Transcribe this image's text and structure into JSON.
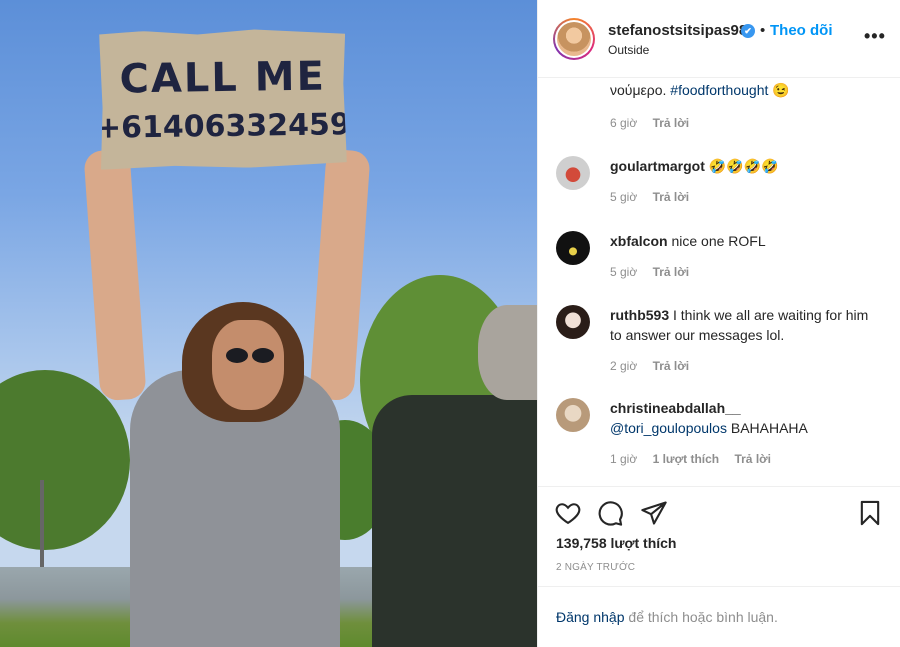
{
  "photo": {
    "sign_line1": "CALL ME",
    "sign_line2": "+61406332459"
  },
  "header": {
    "username": "stefanostsitsipas98",
    "verified_icon": "✔",
    "separator": "•",
    "follow_label": "Theo dõi",
    "location": "Outside",
    "more_icon": "•••"
  },
  "comments": [
    {
      "partial_line": "νούμερο.",
      "hashtag": "#foodforthought",
      "emoji": "😉",
      "time": "6 giờ",
      "reply": "Trả lời"
    },
    {
      "user": "goulartmargot",
      "text": "🤣🤣🤣🤣",
      "time": "5 giờ",
      "reply": "Trả lời",
      "avatar_color": "#c9c9c9"
    },
    {
      "user": "xbfalcon",
      "text": "nice one ROFL",
      "time": "5 giờ",
      "reply": "Trả lời",
      "avatar_color": "#111111"
    },
    {
      "user": "ruthb593",
      "text": "I think we all are waiting for him to answer our messages lol.",
      "time": "2 giờ",
      "reply": "Trả lời",
      "avatar_color": "#e2d5cf"
    },
    {
      "user": "christineabdallah__",
      "mention": "@tori_goulopoulos",
      "text": "BAHAHAHA",
      "time": "1 giờ",
      "likes": "1 lượt thích",
      "reply": "Trả lời",
      "avatar_color": "#d9c9b8"
    }
  ],
  "actions": {
    "like_count": "139,758 lượt thích",
    "date": "2 NGÀY TRƯỚC"
  },
  "login": {
    "link": "Đăng nhập",
    "rest": "để thích hoặc bình luận."
  },
  "colors": {
    "accent": "#0095f6",
    "link": "#00376b",
    "muted": "#8e8e8e"
  }
}
